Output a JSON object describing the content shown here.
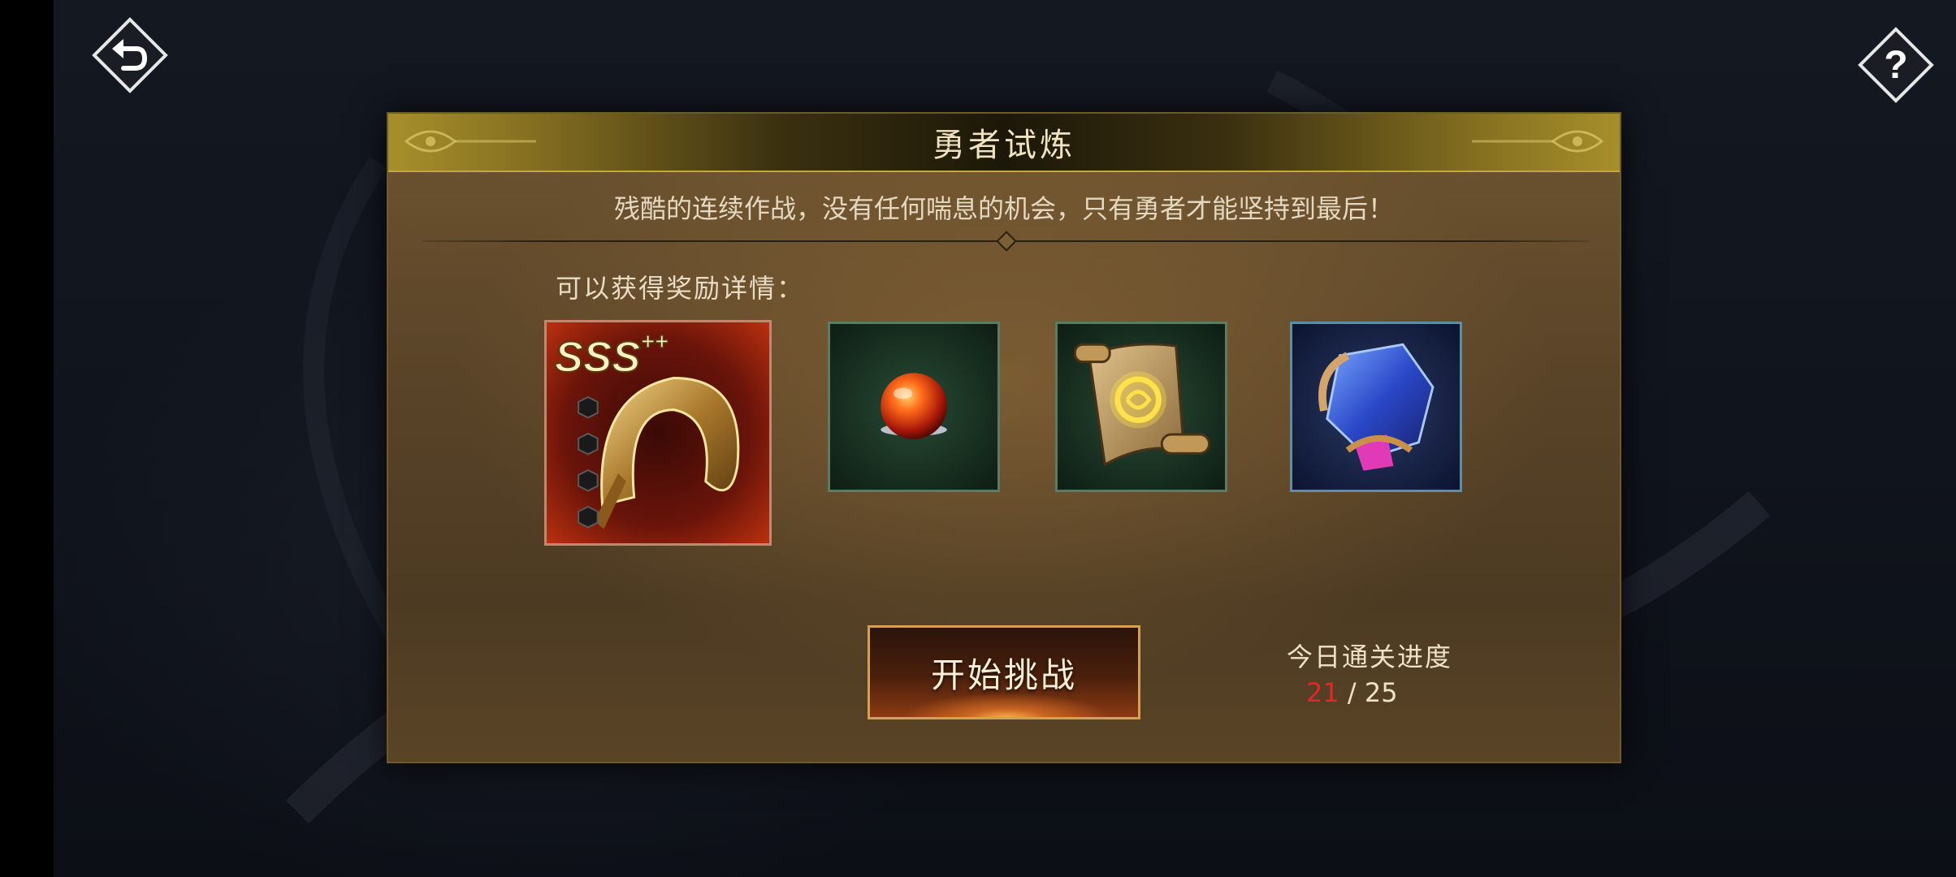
{
  "screen": {
    "back_icon": "undo-arrow-icon",
    "help_icon": "question-mark-icon"
  },
  "panel": {
    "title": "勇者试炼",
    "description": "残酷的连续作战，没有任何喘息的机会，只有勇者才能坚持到最后！",
    "reward_label": "可以获得奖励详情：",
    "rewards": [
      {
        "icon": "golden-ring-icon",
        "grade": "SSS",
        "grade_suffix": "++"
      },
      {
        "icon": "fire-orb-icon"
      },
      {
        "icon": "glowing-scroll-icon"
      },
      {
        "icon": "blue-crystal-icon"
      }
    ],
    "start_button": "开始挑战",
    "progress_title": "今日通关进度",
    "progress_current": "21",
    "progress_separator": " / ",
    "progress_total": "25"
  },
  "colors": {
    "progress_current": "#e02828",
    "title_text": "#f1e3c2",
    "button_border": "#d6a052"
  }
}
